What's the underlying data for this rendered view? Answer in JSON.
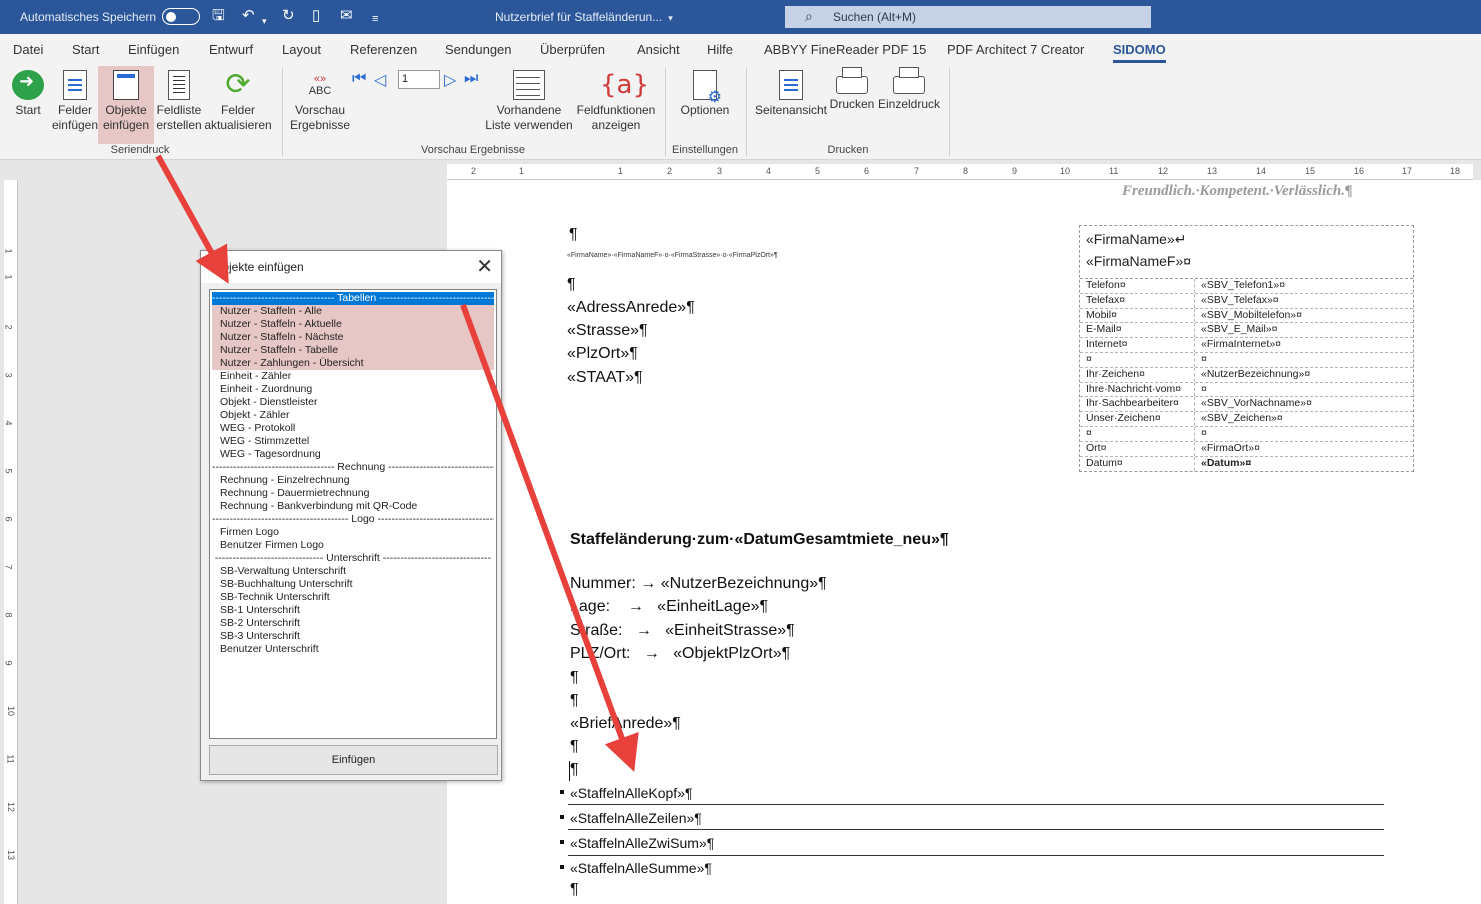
{
  "titlebar": {
    "autosave_label": "Automatisches Speichern",
    "doc_title": "Nutzerbrief für Staffeländerun...",
    "search_placeholder": "Suchen (Alt+M)"
  },
  "tabs": [
    "Datei",
    "Start",
    "Einfügen",
    "Entwurf",
    "Layout",
    "Referenzen",
    "Sendungen",
    "Überprüfen",
    "Ansicht",
    "Hilfe",
    "ABBYY FineReader PDF 15",
    "PDF Architect 7 Creator",
    "SIDOMO"
  ],
  "ribbon": {
    "start": "Start",
    "felder_einfuegen": [
      "Felder",
      "einfügen"
    ],
    "objekte_einfuegen": [
      "Objekte",
      "einfügen"
    ],
    "feldliste": [
      "Feldliste",
      "erstellen"
    ],
    "felder_aktualisieren": [
      "Felder",
      "aktualisieren"
    ],
    "vorschau_ergebnisse": [
      "Vorschau",
      "Ergebnisse"
    ],
    "abc": "ABC",
    "record_number": "1",
    "vorhandene_liste": [
      "Vorhandene",
      "Liste verwenden"
    ],
    "feldfunktionen": [
      "Feldfunktionen",
      "anzeigen"
    ],
    "optionen": "Optionen",
    "seitenansicht": "Seitenansicht",
    "drucken": "Drucken",
    "einzeldruck": "Einzeldruck",
    "groups": [
      "Seriendruck",
      "Vorschau Ergebnisse",
      "Einstellungen",
      "Drucken"
    ]
  },
  "ruler_h": [
    "2",
    "1",
    "1",
    "2",
    "3",
    "4",
    "5",
    "6",
    "7",
    "8",
    "9",
    "10",
    "11",
    "12",
    "13",
    "14",
    "15",
    "16",
    "17",
    "18"
  ],
  "ruler_v": [
    "1",
    "1",
    "2",
    "3",
    "4",
    "5",
    "6",
    "7",
    "8",
    "9",
    "10",
    "11",
    "12",
    "13"
  ],
  "document": {
    "slogan": "Freundlich.·Kompetent.·Verlässlich.¶",
    "pilcrow": "¶",
    "sender_line": "«FirmaName»·«FirmaNameF»·o·«FirmaStrasse»·o·«FirmaPlzOrt»¶",
    "address": [
      "«AdressAnrede»¶",
      "«Strasse»¶",
      "«PlzOrt»¶",
      "«STAAT»¶"
    ],
    "info_head": [
      "«FirmaName»↵",
      "«FirmaNameF»¤"
    ],
    "info_rows": [
      [
        "Telefon¤",
        "«SBV_Telefon1»¤"
      ],
      [
        "Telefax¤",
        "«SBV_Telefax»¤"
      ],
      [
        "Mobil¤",
        "«SBV_Mobiltelefon»¤"
      ],
      [
        "E-Mail¤",
        "«SBV_E_Mail»¤"
      ],
      [
        "Internet¤",
        "«FirmaInternet»¤"
      ],
      [
        "¤",
        "¤"
      ],
      [
        "Ihr·Zeichen¤",
        "«NutzerBezeichnung»¤"
      ],
      [
        "Ihre·Nachricht·vom¤",
        "¤"
      ],
      [
        "Ihr·Sachbearbeiter¤",
        "«SBV_VorNachname»¤"
      ],
      [
        "Unser·Zeichen¤",
        "«SBV_Zeichen»¤"
      ],
      [
        "¤",
        "¤"
      ],
      [
        "Ort¤",
        "«FirmaOrt»¤"
      ],
      [
        "Datum¤",
        "«Datum»¤"
      ]
    ],
    "subject": "Staffeländerung·zum·«DatumGesamtmiete_neu»¶",
    "fields": [
      [
        "Nummer:",
        "→",
        "«NutzerBezeichnung»¶"
      ],
      [
        "Lage:",
        "→",
        "«EinheitLage»¶"
      ],
      [
        "Straße:",
        "→",
        "«EinheitStrasse»¶"
      ],
      [
        "PLZ/Ort:",
        "→",
        "«ObjektPlzOrt»¶"
      ]
    ],
    "brief_anrede": "«BriefAnrede»¶",
    "table_fields": [
      "«StaffelnAlleKopf»¶",
      "«StaffelnAlleZeilen»¶",
      "«StaffelnAlleZwiSum»¶",
      "«StaffelnAlleSumme»¶"
    ]
  },
  "dialog": {
    "title": "Objekte einfügen",
    "items": [
      {
        "text": "----------------------------------- Tabellen -----------------------------------",
        "kind": "sel"
      },
      {
        "text": "Nutzer - Staffeln - Alle",
        "kind": "hl"
      },
      {
        "text": "Nutzer - Staffeln - Aktuelle",
        "kind": "hl"
      },
      {
        "text": "Nutzer - Staffeln - Nächste",
        "kind": "hl"
      },
      {
        "text": "Nutzer - Staffeln - Tabelle",
        "kind": "hl"
      },
      {
        "text": "Nutzer - Zahlungen - Übersicht",
        "kind": "hl"
      },
      {
        "text": "Einheit - Zähler",
        "kind": ""
      },
      {
        "text": "Einheit - Zuordnung",
        "kind": ""
      },
      {
        "text": "Objekt - Dienstleister",
        "kind": ""
      },
      {
        "text": "Objekt - Zähler",
        "kind": ""
      },
      {
        "text": "WEG - Protokoll",
        "kind": ""
      },
      {
        "text": "WEG - Stimmzettel",
        "kind": ""
      },
      {
        "text": "WEG - Tagesordnung",
        "kind": ""
      },
      {
        "text": "----------------------------------- Rechnung -----------------------------------",
        "kind": "hd"
      },
      {
        "text": "Rechnung - Einzelrechnung",
        "kind": ""
      },
      {
        "text": "Rechnung - Dauermietrechnung",
        "kind": ""
      },
      {
        "text": "Rechnung - Bankverbindung mit QR-Code",
        "kind": ""
      },
      {
        "text": "--------------------------------------- Logo ---------------------------------------",
        "kind": "hd"
      },
      {
        "text": "Firmen Logo",
        "kind": ""
      },
      {
        "text": "Benutzer Firmen Logo",
        "kind": ""
      },
      {
        "text": "------------------------------- Unterschrift -------------------------------",
        "kind": "hd"
      },
      {
        "text": "SB-Verwaltung Unterschrift",
        "kind": ""
      },
      {
        "text": "SB-Buchhaltung Unterschrift",
        "kind": ""
      },
      {
        "text": "SB-Technik Unterschrift",
        "kind": ""
      },
      {
        "text": "SB-1 Unterschrift",
        "kind": ""
      },
      {
        "text": "SB-2 Unterschrift",
        "kind": ""
      },
      {
        "text": "SB-3 Unterschrift",
        "kind": ""
      },
      {
        "text": "Benutzer Unterschrift",
        "kind": ""
      }
    ],
    "button": "Einfügen"
  },
  "colors": {
    "accent": "#2b579a",
    "highlight": "#e7c6c6",
    "selection": "#0078d7",
    "arrow": "#e8413c"
  }
}
